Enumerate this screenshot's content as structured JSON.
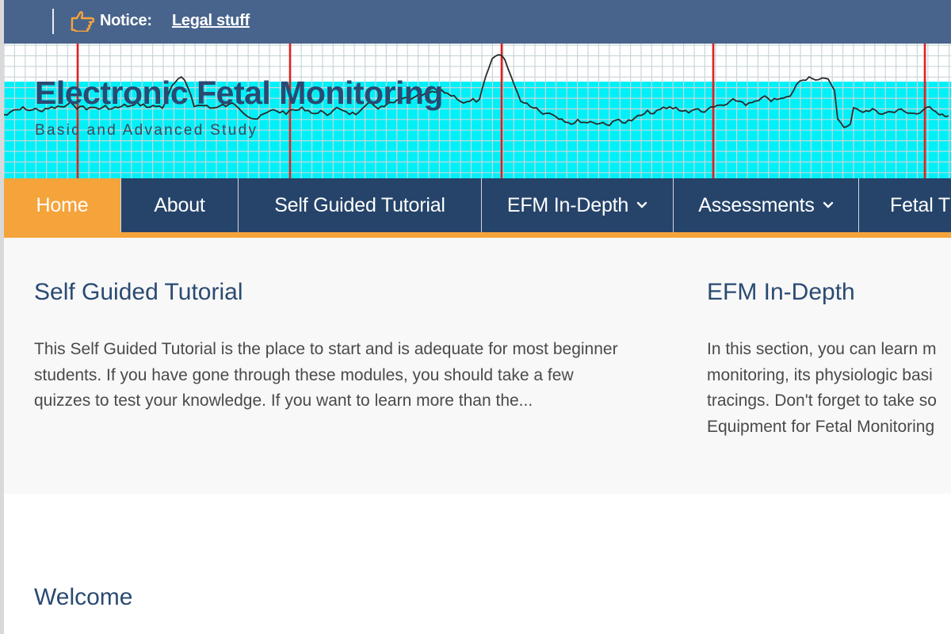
{
  "notice": {
    "icon": "pointing-hand-icon",
    "label": "Notice:",
    "link_text": "Legal stuff"
  },
  "header": {
    "title": "Electronic Fetal Monitoring",
    "tagline": "Basic and Advanced Study",
    "background": "fetal-heart-tracing-graph"
  },
  "nav": {
    "items": [
      {
        "label": "Home",
        "active": true,
        "dropdown": false
      },
      {
        "label": "About",
        "active": false,
        "dropdown": false
      },
      {
        "label": "Self Guided Tutorial",
        "active": false,
        "dropdown": false
      },
      {
        "label": "EFM In-Depth",
        "active": false,
        "dropdown": true
      },
      {
        "label": "Assessments",
        "active": false,
        "dropdown": true
      },
      {
        "label": "Fetal T",
        "active": false,
        "dropdown": false
      }
    ]
  },
  "sections": [
    {
      "title": "Self Guided Tutorial",
      "lines": [
        "This Self Guided Tutorial is the place to start and is adequate for most beginner",
        "students. If you have gone through these modules, you should take a few",
        "quizzes to test your knowledge. If you want to learn more than the..."
      ]
    },
    {
      "title": "EFM In-Depth",
      "lines": [
        "In this section, you can learn m",
        "monitoring, its physiologic basi",
        "tracings. Don't forget to take so",
        "Equipment for Fetal Monitoring"
      ]
    }
  ],
  "welcome": {
    "title": "Welcome"
  },
  "colors": {
    "notice_bar": "#48648c",
    "nav_bg": "#26446a",
    "accent_orange": "#f5a33b",
    "title_blue": "#2a4a72",
    "tracing_cyan": "#00f0f8",
    "tracing_red": "#e02020"
  }
}
